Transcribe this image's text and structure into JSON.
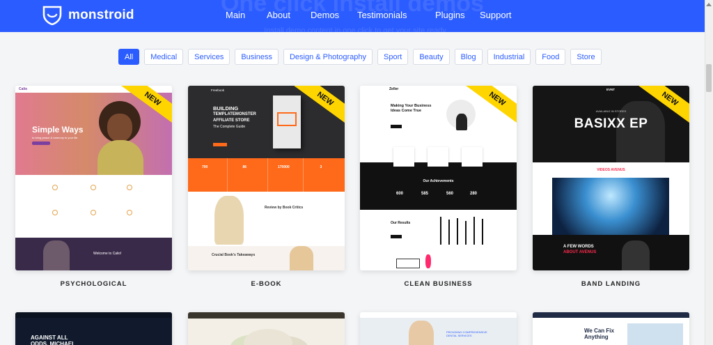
{
  "header": {
    "brand": "monstroid",
    "ghost_title": "One click install demos",
    "ghost_subtitle": "Install demo content in one click to get your site ready",
    "nav": [
      "Main",
      "About",
      "Demos",
      "Testimonials",
      "Plugins",
      "Support"
    ]
  },
  "filters": [
    "All",
    "Medical",
    "Services",
    "Business",
    "Design & Photography",
    "Sport",
    "Beauty",
    "Blog",
    "Industrial",
    "Food",
    "Store"
  ],
  "active_filter": "All",
  "ribbon": "NEW",
  "cards": [
    {
      "title": "PSYCHOLOGICAL",
      "logo": "Calio",
      "hero": "Simple Ways",
      "hero_sub": "to bring peace & harmony to your life",
      "footer_heading": "Welcome to Calio!"
    },
    {
      "title": "E-BOOK",
      "logo": "Freebook",
      "hero_lines": [
        "BUILDING",
        "TEMPLATEMONSTER",
        "AFFILIATE STORE",
        "The Complete Guide"
      ],
      "stats": [
        "700",
        "86",
        "170000",
        "3"
      ],
      "review": "Review by Book Critics",
      "takeaways": "Crucial Book's Takeaways"
    },
    {
      "title": "CLEAN BUSINESS",
      "logo": "Zeller",
      "hero": "Making Your Business Ideas Come True",
      "achievements": "Our Achievements",
      "stats": [
        "600",
        "585",
        "560",
        "280"
      ],
      "results": "Our Results"
    },
    {
      "title": "BAND LANDING",
      "logo": "EVNT",
      "available": "AVAILABLE IN STORES",
      "hero": "BASIXX EP",
      "videos": "VIDEOS AVENUS",
      "few_words_1": "A FEW WORDS",
      "few_words_2": "ABOUT AVENUS"
    }
  ],
  "bottom_cards": [
    {
      "text": "AGAINST ALL ODDS, MICHAEL"
    },
    {
      "text": ""
    },
    {
      "text": "PROVIDING COMPREHENSIVE DENTAL SERVICES"
    },
    {
      "text": "We Can Fix Anything"
    }
  ],
  "colors": {
    "header": "#2b5cff",
    "accent": "#2b5cff",
    "ribbon": "#ffd500",
    "ebook_orange": "#ff6a1a",
    "band_red": "#ff2a4d"
  }
}
